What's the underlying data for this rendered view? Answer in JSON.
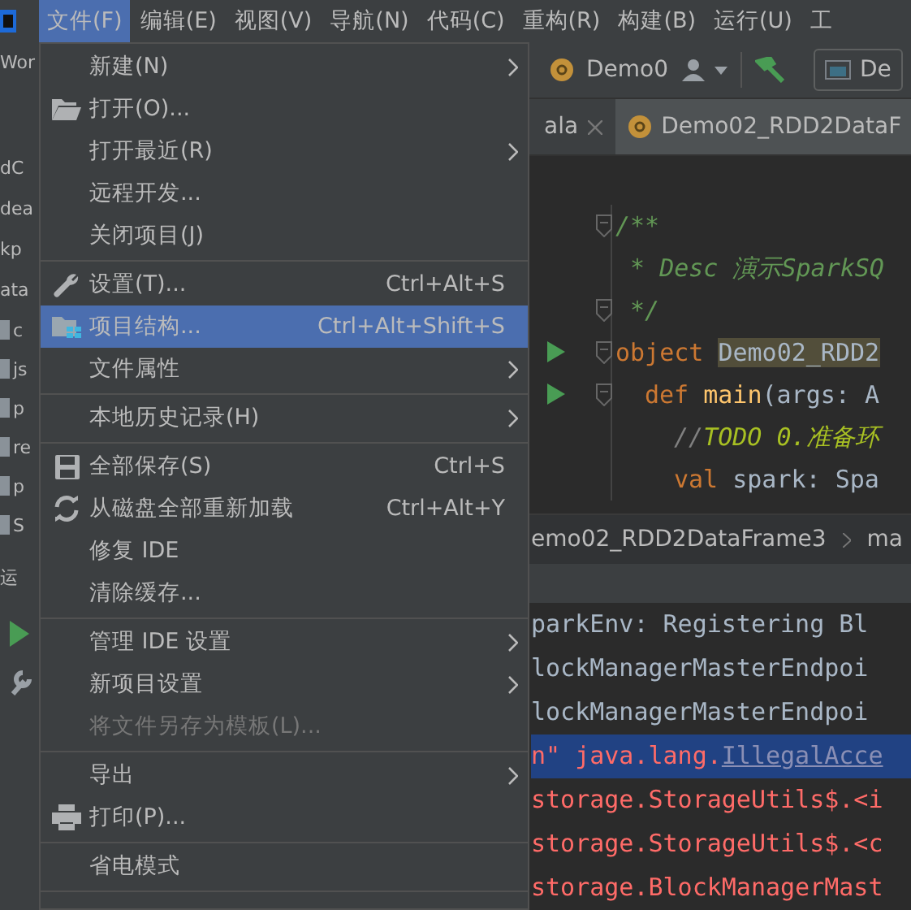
{
  "menubar": [
    {
      "label": "文件(F)",
      "selected": true
    },
    {
      "label": "编辑(E)",
      "selected": false
    },
    {
      "label": "视图(V)",
      "selected": false
    },
    {
      "label": "导航(N)",
      "selected": false
    },
    {
      "label": "代码(C)",
      "selected": false
    },
    {
      "label": "重构(R)",
      "selected": false
    },
    {
      "label": "构建(B)",
      "selected": false
    },
    {
      "label": "运行(U)",
      "selected": false
    },
    {
      "label": "工",
      "selected": false
    }
  ],
  "side_panel": {
    "texts": [
      "Wor",
      "dC",
      "dea",
      "kp",
      "ata"
    ],
    "files": [
      "c",
      "js",
      "p",
      "re",
      "p",
      "S"
    ],
    "tab": "运"
  },
  "toolbar": {
    "breadcrumb": "Demo0",
    "run_config": "De"
  },
  "editor_tabs": [
    {
      "label": "ala",
      "selected": false
    },
    {
      "label": "Demo02_RDD2DataF",
      "selected": true
    }
  ],
  "code": [
    {
      "run": false,
      "fold": true,
      "segments": [
        {
          "text": "/**",
          "kind": "doc"
        }
      ]
    },
    {
      "run": false,
      "fold": false,
      "segments": [
        {
          "text": " * Desc 演示SparkSQ",
          "kind": "doc"
        }
      ]
    },
    {
      "run": false,
      "fold": true,
      "segments": [
        {
          "text": " */",
          "kind": "doc"
        }
      ]
    },
    {
      "run": true,
      "fold": true,
      "segments": [
        {
          "text": "object ",
          "kind": "keyword"
        },
        {
          "text": "Demo02_RDD2",
          "kind": "highlight"
        }
      ],
      "children": [
        {
          "run": true,
          "fold": true,
          "segments": [
            {
              "text": "def ",
              "kind": "keyword"
            },
            {
              "text": "main",
              "kind": "name"
            },
            {
              "text": "(args: A",
              "kind": "plain"
            }
          ],
          "children": [
            {
              "run": false,
              "fold": false,
              "segments": [
                {
                  "text": "//",
                  "kind": "comment"
                },
                {
                  "text": "TODO 0.准备环",
                  "kind": "todo"
                }
              ]
            },
            {
              "run": false,
              "fold": false,
              "segments": [
                {
                  "text": "val ",
                  "kind": "keyword"
                },
                {
                  "text": "spark: Spa",
                  "kind": "plain"
                }
              ]
            }
          ]
        }
      ]
    }
  ],
  "breadcrumb": [
    "emo02_RDD2DataFrame3",
    "ma"
  ],
  "console": [
    {
      "selected": false,
      "segments": [
        {
          "text": "parkEnv: Registering Bl",
          "kind": "plain"
        }
      ]
    },
    {
      "selected": false,
      "segments": [
        {
          "text": "lockManagerMasterEndpoi",
          "kind": "plain"
        }
      ]
    },
    {
      "selected": false,
      "segments": [
        {
          "text": "lockManagerMasterEndpoi",
          "kind": "plain"
        }
      ]
    },
    {
      "selected": true,
      "segments": [
        {
          "text": "n\" java.lang.",
          "kind": "error"
        },
        {
          "text": "IllegalAcce",
          "kind": "link"
        }
      ]
    },
    {
      "selected": false,
      "segments": [
        {
          "text": "storage.StorageUtils$.<i",
          "kind": "error"
        }
      ]
    },
    {
      "selected": false,
      "segments": [
        {
          "text": "storage.StorageUtils$.<c",
          "kind": "error"
        }
      ]
    },
    {
      "selected": false,
      "segments": [
        {
          "text": "storage.BlockManagerMast",
          "kind": "error"
        }
      ]
    }
  ],
  "file_menu": [
    {
      "kind": "item",
      "label": "新建(N)",
      "submenu": true,
      "selected": false,
      "disabled": false
    },
    {
      "kind": "item",
      "label": "打开(O)...",
      "submenu": false,
      "selected": false,
      "disabled": false
    },
    {
      "kind": "item",
      "label": "打开最近(R)",
      "submenu": true,
      "selected": false,
      "disabled": false
    },
    {
      "kind": "item",
      "label": "远程开发...",
      "submenu": false,
      "selected": false,
      "disabled": false
    },
    {
      "kind": "item",
      "label": "关闭项目(J)",
      "submenu": false,
      "selected": false,
      "disabled": false
    },
    {
      "kind": "separator"
    },
    {
      "kind": "item",
      "label": "设置(T)...",
      "shortcut": "Ctrl+Alt+S",
      "submenu": false,
      "selected": false,
      "disabled": false
    },
    {
      "kind": "item",
      "label": "项目结构...",
      "shortcut": "Ctrl+Alt+Shift+S",
      "submenu": false,
      "selected": true,
      "disabled": false
    },
    {
      "kind": "item",
      "label": "文件属性",
      "submenu": true,
      "selected": false,
      "disabled": false
    },
    {
      "kind": "separator"
    },
    {
      "kind": "item",
      "label": "本地历史记录(H)",
      "submenu": true,
      "selected": false,
      "disabled": false
    },
    {
      "kind": "separator"
    },
    {
      "kind": "item",
      "label": "全部保存(S)",
      "shortcut": "Ctrl+S",
      "submenu": false,
      "selected": false,
      "disabled": false
    },
    {
      "kind": "item",
      "label": "从磁盘全部重新加载",
      "shortcut": "Ctrl+Alt+Y",
      "submenu": false,
      "selected": false,
      "disabled": false
    },
    {
      "kind": "item",
      "label": "修复 IDE",
      "submenu": false,
      "selected": false,
      "disabled": false
    },
    {
      "kind": "item",
      "label": "清除缓存...",
      "submenu": false,
      "selected": false,
      "disabled": false
    },
    {
      "kind": "separator"
    },
    {
      "kind": "item",
      "label": "管理 IDE 设置",
      "submenu": true,
      "selected": false,
      "disabled": false
    },
    {
      "kind": "item",
      "label": "新项目设置",
      "submenu": true,
      "selected": false,
      "disabled": false
    },
    {
      "kind": "item",
      "label": "将文件另存为模板(L)...",
      "submenu": false,
      "selected": false,
      "disabled": true
    },
    {
      "kind": "separator"
    },
    {
      "kind": "item",
      "label": "导出",
      "submenu": true,
      "selected": false,
      "disabled": false
    },
    {
      "kind": "item",
      "label": "打印(P)...",
      "submenu": false,
      "selected": false,
      "disabled": false
    },
    {
      "kind": "separator"
    },
    {
      "kind": "item",
      "label": "省电模式",
      "submenu": false,
      "selected": false,
      "disabled": false
    },
    {
      "kind": "separator"
    }
  ]
}
